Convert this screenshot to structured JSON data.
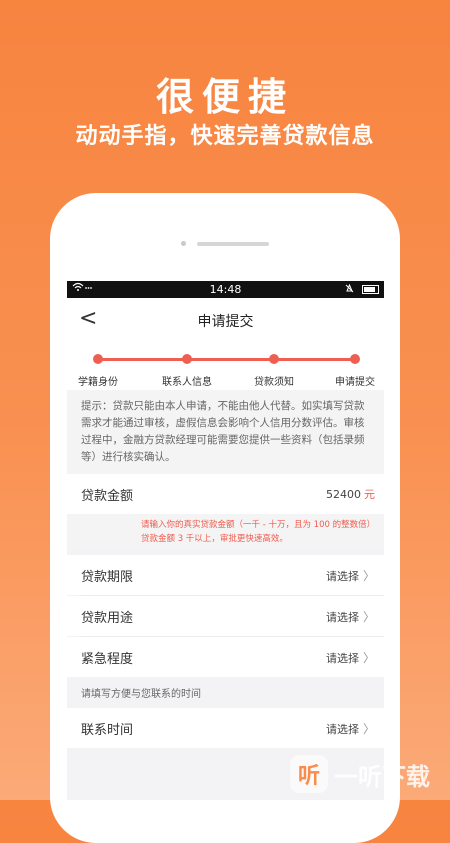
{
  "promo": {
    "title": "很便捷",
    "subtitle": "动动手指，快速完善贷款信息"
  },
  "status_bar": {
    "time": "14:48",
    "left_icons": "wifi-icon",
    "right_icons": [
      "alarm-icon",
      "battery-icon"
    ]
  },
  "header": {
    "title": "申请提交",
    "back": "<"
  },
  "steps": [
    "学籍身份",
    "联系人信息",
    "贷款须知",
    "申请提交"
  ],
  "notice": "提示：贷款只能由本人申请，不能由他人代替。如实填写贷款需求才能通过审核，虚假信息会影响个人信用分数评估。审核过程中，金融方贷款经理可能需要您提供一些资料（包括录频等）进行核实确认。",
  "amount": {
    "label": "贷款金额",
    "value": "52400",
    "unit": "元",
    "hint_line1": "请输入你的真实贷款金额（一千 - 十万，且为 100 的整数倍）",
    "hint_line2": "贷款金额 3 千以上，审批更快速高效。"
  },
  "fields": [
    {
      "label": "贷款期限",
      "value": "请选择"
    },
    {
      "label": "贷款用途",
      "value": "请选择"
    },
    {
      "label": "紧急程度",
      "value": "请选择"
    }
  ],
  "contact_section_label": "请填写方便与您联系的时间",
  "contact_time": {
    "label": "联系时间",
    "value": "请选择"
  },
  "watermark": {
    "icon": "听",
    "text": "一听下载"
  },
  "colors": {
    "accent": "#ee5f52",
    "background_top": "#f7843f",
    "background_bottom": "#fbaa78"
  }
}
